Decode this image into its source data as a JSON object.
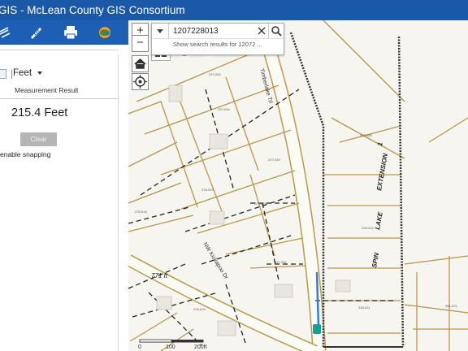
{
  "app": {
    "title": "GIS - McLean County GIS Consortium",
    "brand_color": "#1a58a8"
  },
  "toolbar": {
    "tools": [
      {
        "name": "measure-icon"
      },
      {
        "name": "ruler-icon"
      },
      {
        "name": "print-icon"
      },
      {
        "name": "layers-icon"
      }
    ]
  },
  "measure_panel": {
    "unit": "Feet",
    "result_label": "Measurement Result",
    "result_value": "215.4 Feet",
    "clear_label": "Clear",
    "snapping_label": "enable snapping"
  },
  "search": {
    "value": "1207228013",
    "suggestion": "Show search results for 12072 ..."
  },
  "map": {
    "street_labels": [
      "Timberlake Trl",
      "NW Kickapoo Dr"
    ],
    "lake_labels": [
      "SPIN",
      "LAKE",
      "EXTENSION",
      "1"
    ],
    "measure_label": "771 ft",
    "scale_labels": [
      "0",
      "100",
      "200ft"
    ]
  }
}
